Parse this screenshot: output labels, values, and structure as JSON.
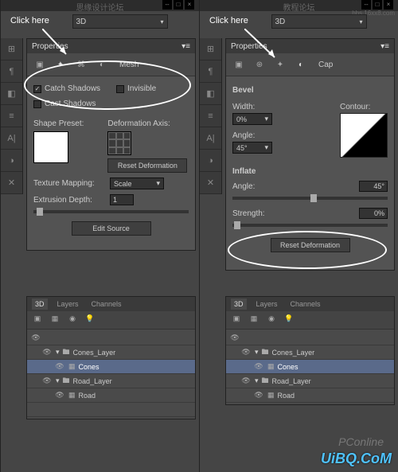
{
  "watermarks": {
    "top_left": "思缘设计论坛",
    "top_right": "教程论坛",
    "bbs": "bbs.16xx8.com",
    "pc": "PConline",
    "logo": "UiBQ.CoM"
  },
  "click_here": "Click here",
  "dropdown_3d": "3D",
  "left": {
    "panel_title": "Properties",
    "tab_label": "Mesh",
    "catch_shadows": "Catch Shadows",
    "cast_shadows": "Cast Shadows",
    "invisible": "Invisible",
    "shape_preset": "Shape Preset:",
    "deform_axis": "Deformation Axis:",
    "reset_deform": "Reset Deformation",
    "tex_map": "Texture Mapping:",
    "tex_map_val": "Scale",
    "ext_depth": "Extrusion Depth:",
    "ext_val": "1",
    "edit_src": "Edit Source"
  },
  "right": {
    "panel_title": "Properties",
    "tab_label": "Cap",
    "bevel": "Bevel",
    "width": "Width:",
    "width_val": "0%",
    "contour": "Contour:",
    "angle": "Angle:",
    "angle_val": "45°",
    "inflate": "Inflate",
    "inflate_angle": "Angle:",
    "inflate_angle_val": "45°",
    "strength": "Strength:",
    "strength_val": "0%",
    "reset_deform": "Reset Deformation"
  },
  "panel3d": {
    "tabs": [
      "3D",
      "Layers",
      "Channels"
    ],
    "layers": [
      {
        "name": "Cones_Layer",
        "type": "folder",
        "indent": 1
      },
      {
        "name": "Cones",
        "type": "item",
        "indent": 2,
        "selected": true
      },
      {
        "name": "Road_Layer",
        "type": "folder",
        "indent": 1
      },
      {
        "name": "Road",
        "type": "item",
        "indent": 2
      }
    ]
  }
}
